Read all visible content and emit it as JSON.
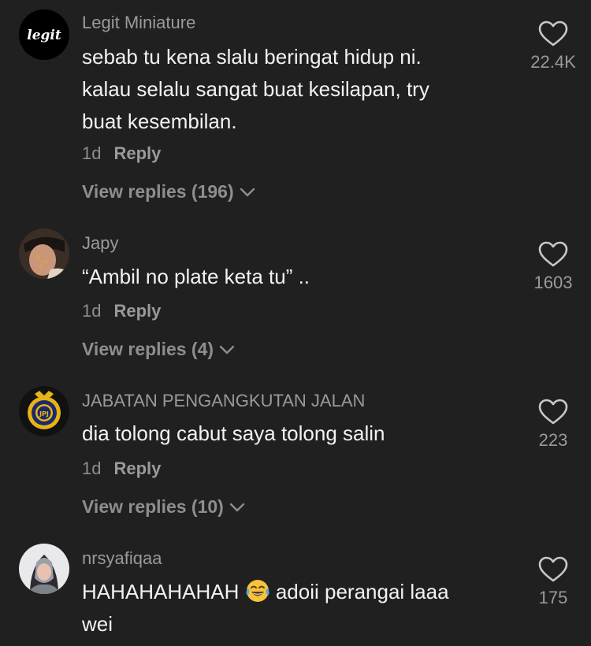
{
  "comments": [
    {
      "username": "Legit Miniature",
      "avatar_text": "legit",
      "lines": [
        "sebab tu kena slalu beringat hidup ni.",
        "kalau selalu sangat buat kesilapan, try",
        "buat kesembilan."
      ],
      "time": "1d",
      "reply_label": "Reply",
      "view_replies": "View replies (196)",
      "likes": "22.4K"
    },
    {
      "username": "Japy",
      "lines": [
        "“Ambil no plate keta tu” .."
      ],
      "time": "1d",
      "reply_label": "Reply",
      "view_replies": "View replies (4)",
      "likes": "1603"
    },
    {
      "username": "JABATAN PENGANGKUTAN JALAN",
      "avatar_text": "JPJ",
      "lines": [
        "dia tolong cabut saya tolong salin"
      ],
      "time": "1d",
      "reply_label": "Reply",
      "view_replies": "View replies (10)",
      "likes": "223"
    },
    {
      "username": "nrsyafiqaa",
      "line1_before_emoji": "HAHAHAHAHAH",
      "line1_after_emoji": " adoii perangai laaa",
      "line2": "wei",
      "likes": "175"
    }
  ],
  "colors": {
    "background": "#202020",
    "text": "#f2f2f2",
    "secondary": "#9a9a9a",
    "jpj_gold": "#e7b416",
    "jpj_navy": "#1c2a6b"
  }
}
